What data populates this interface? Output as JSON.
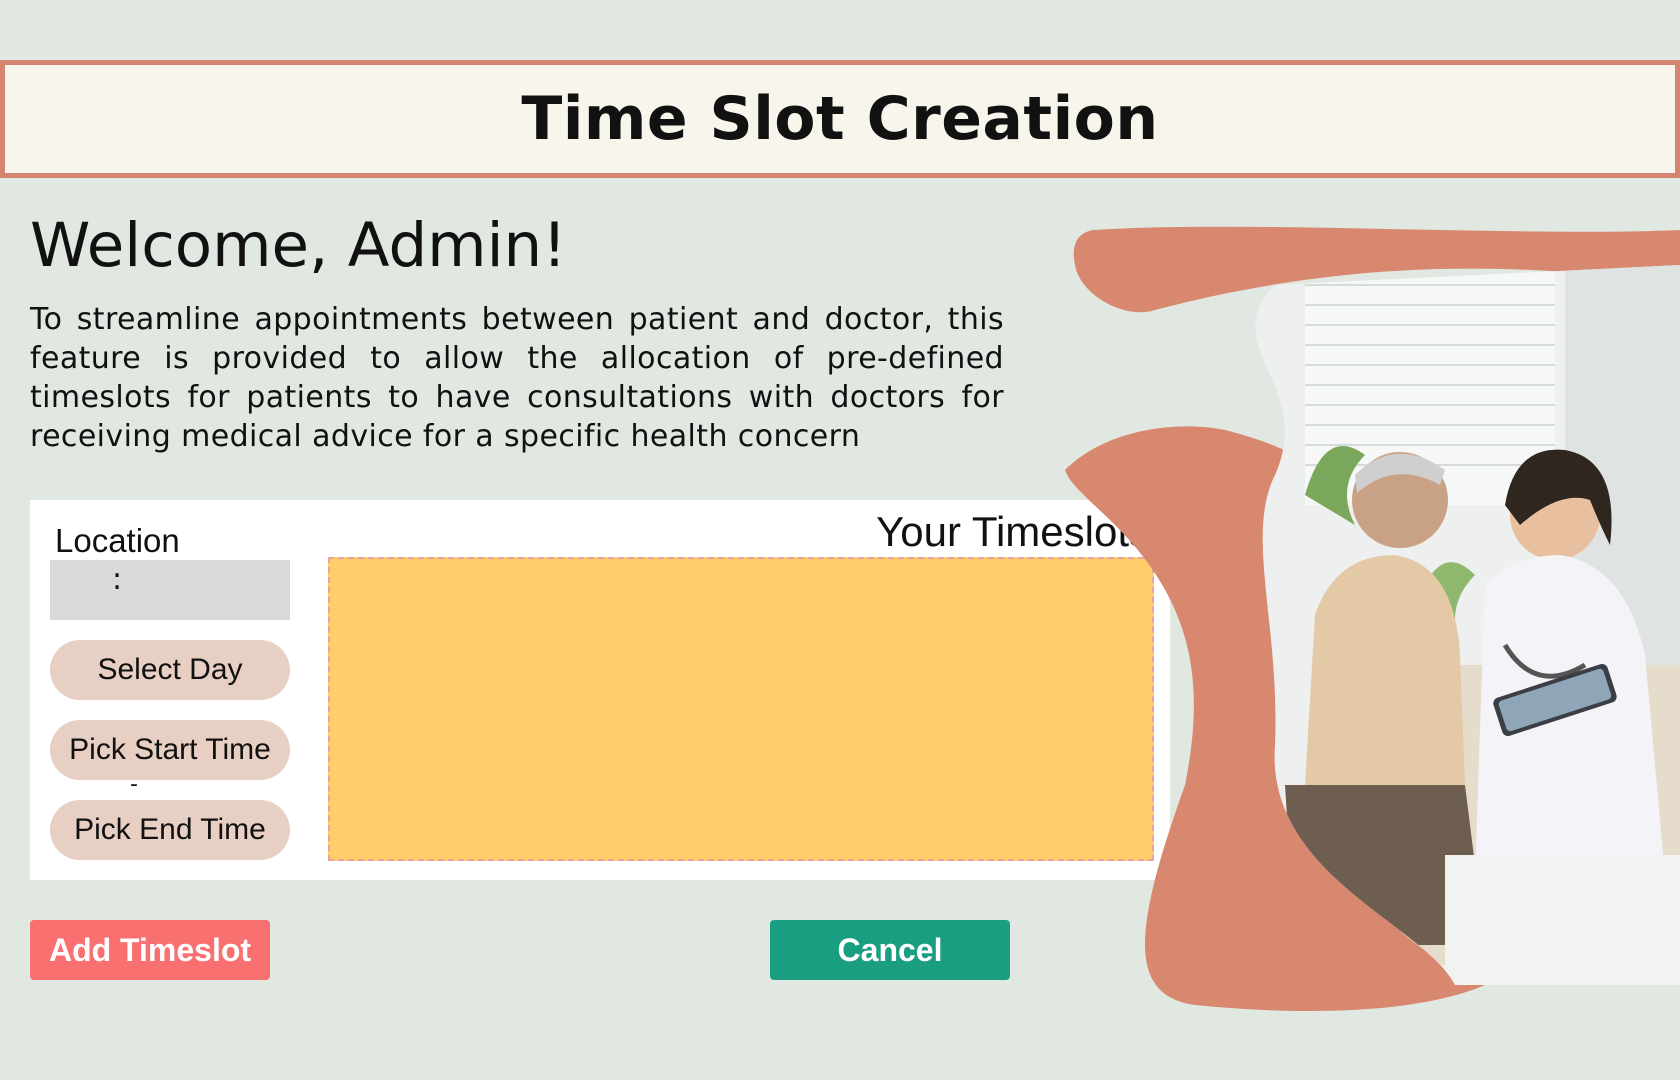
{
  "header": {
    "title": "Time Slot Creation"
  },
  "main": {
    "welcome": "Welcome, Admin!",
    "intro": "To streamline appointments between patient and doctor, this feature is provided to allow the allocation of pre-defined timeslots for patients to have consultations with doctors for receiving medical advice for a specific health concern"
  },
  "form": {
    "location_label": "Location",
    "location_value": ":",
    "select_day_label": "Select Day",
    "start_time_label": "Pick Start Time",
    "separator": "-",
    "end_time_label": "Pick End Time"
  },
  "timeslots": {
    "title": "Your Timeslots",
    "items": []
  },
  "actions": {
    "add_label": "Add Timeslot",
    "cancel_label": "Cancel"
  },
  "colors": {
    "accent": "#d48671",
    "timeslot_area": "#ffcd69",
    "add_button": "#f87070",
    "cancel_button": "#1a9e82",
    "pill": "#e8cfc4"
  },
  "illustration": {
    "icon": "doctor-patient-consultation-photo"
  }
}
